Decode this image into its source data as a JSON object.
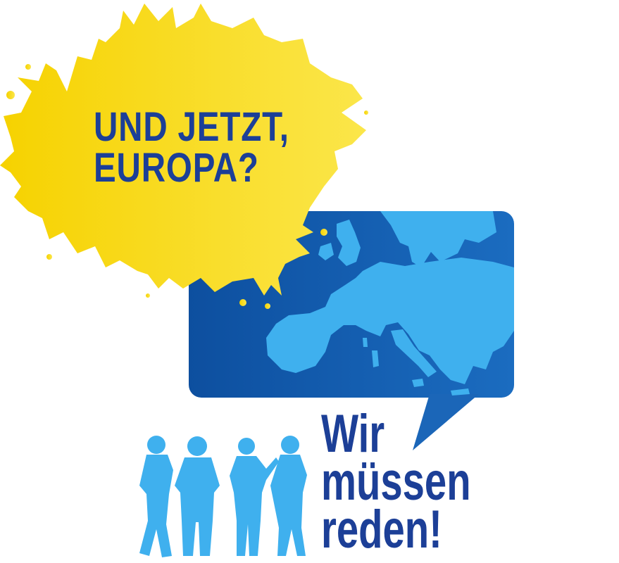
{
  "headline": {
    "line1": "UND JETZT,",
    "line2": "EUROPA?"
  },
  "slogan": {
    "line1": "Wir",
    "line2": "müssen",
    "line3": "reden!"
  },
  "colors": {
    "splash_yellow": "#f7d900",
    "speech_bubble_blue": "#0b58a8",
    "map_light_blue": "#3fb0ee",
    "text_dark_blue": "#1c3f97",
    "people_blue": "#3fb0ee"
  },
  "illustrations": {
    "splash": "yellow-paint-splash",
    "bubble": "speech-bubble-with-europe-map",
    "people": "group-of-four-people-silhouettes"
  }
}
